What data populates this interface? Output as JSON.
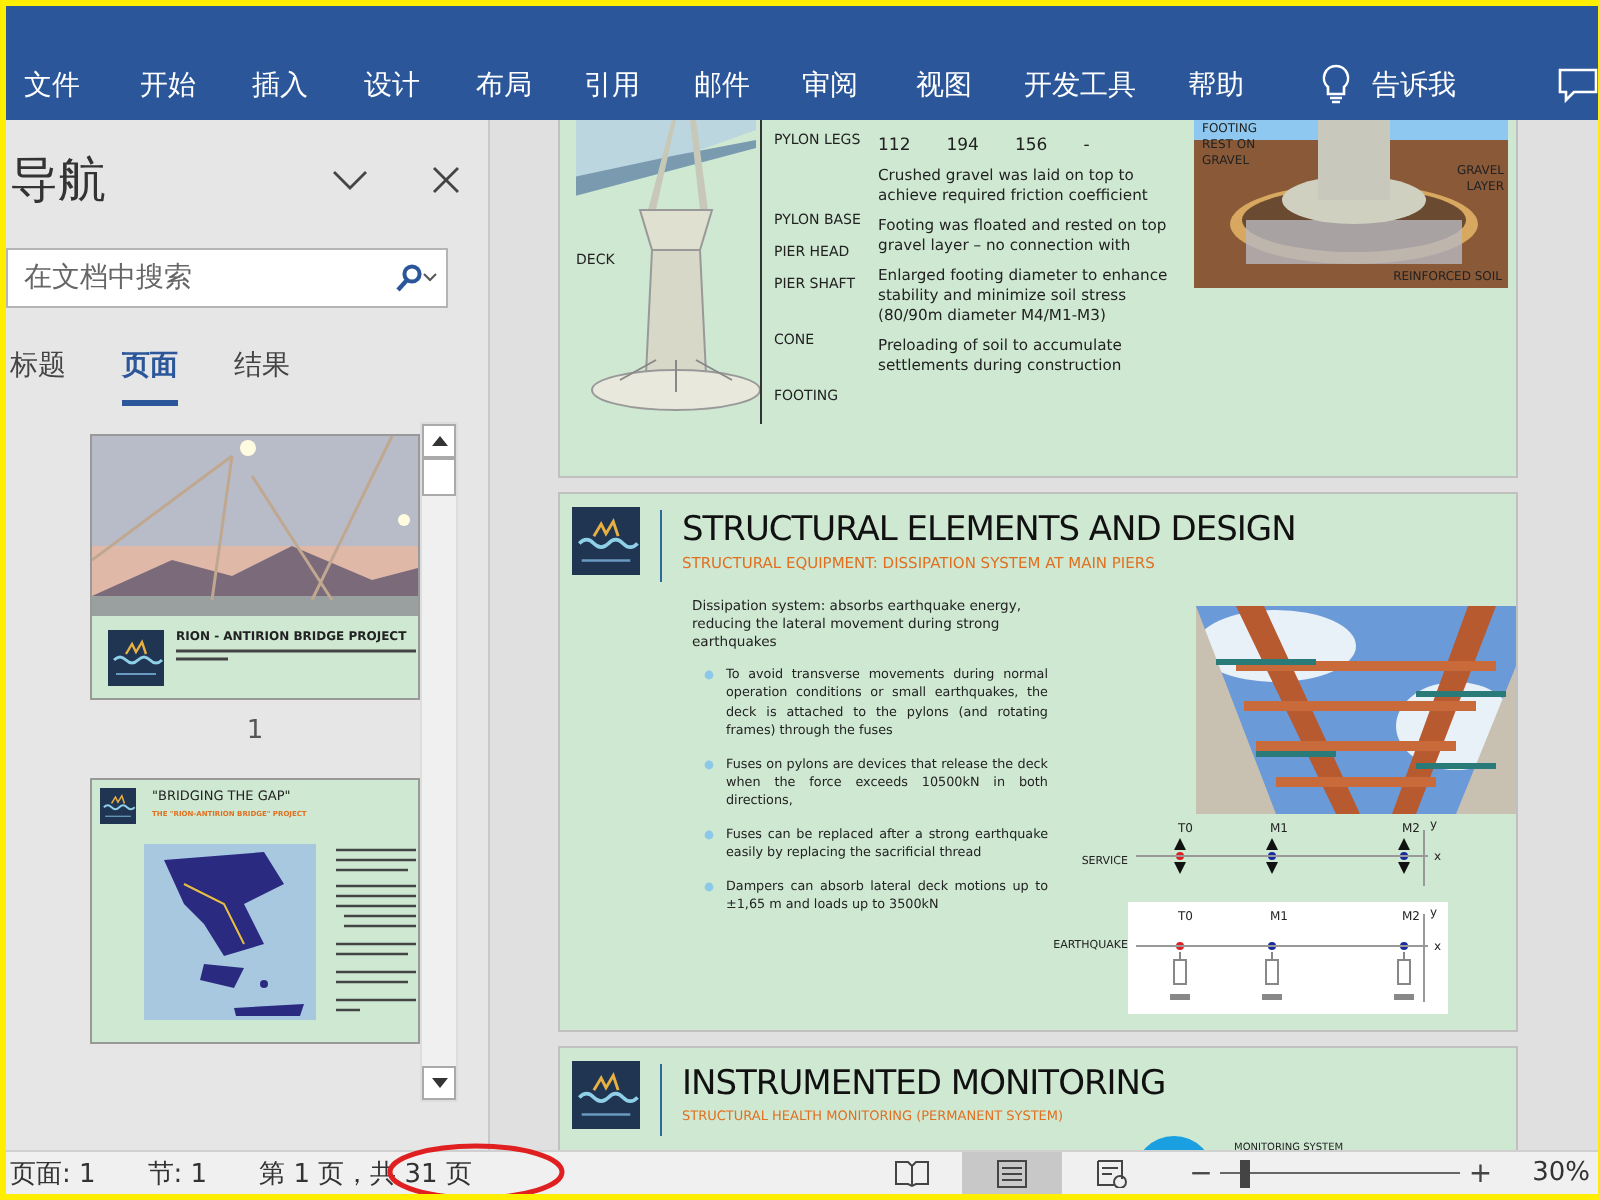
{
  "ribbon": {
    "tabs": [
      "文件",
      "开始",
      "插入",
      "设计",
      "布局",
      "引用",
      "邮件",
      "审阅",
      "视图",
      "开发工具",
      "帮助"
    ],
    "tell_me": "告诉我"
  },
  "navigation": {
    "title": "导航",
    "search": {
      "placeholder": "在文档中搜索"
    },
    "tabs": [
      {
        "label": "标题",
        "selected": false
      },
      {
        "label": "页面",
        "selected": true
      },
      {
        "label": "结果",
        "selected": false
      }
    ],
    "thumbnails": [
      {
        "kind": "cover",
        "title": "RION - ANTIRION BRIDGE PROJECT",
        "number": "1"
      },
      {
        "kind": "map",
        "title": "\"BRIDGING THE GAP\"",
        "subtitle": "THE \"RION-ANTIRION BRIDGE\" PROJECT"
      }
    ]
  },
  "pages": [
    {
      "kind": "pylon",
      "levels": [
        "PYLON LEGS",
        "PYLON BASE",
        "PIER HEAD",
        "PIER SHAFT",
        "CONE",
        "FOOTING"
      ],
      "deck_label": "DECK",
      "values": [
        "112",
        "194",
        "156",
        "-"
      ],
      "notes": [
        "Crushed gravel was laid on top to achieve required friction coefficient",
        "Footing was floated and rested on top gravel layer – no connection with",
        "Enlarged footing diameter to enhance stability and minimize soil stress (80/90m diameter M4/M1-M3)",
        "Preloading of soil to accumulate settlements during construction"
      ],
      "picture_labels": [
        "FOOTING REST ON GRAVEL",
        "GRAVEL LAYER",
        "REINFORCED SOIL"
      ]
    },
    {
      "kind": "dissipation",
      "title": "STRUCTURAL ELEMENTS AND DESIGN",
      "subtitle": "STRUCTURAL EQUIPMENT: DISSIPATION SYSTEM AT MAIN PIERS",
      "intro": "Dissipation system: absorbs earthquake energy, reducing the lateral movement during strong earthquakes",
      "bullets": [
        "To avoid transverse movements during normal operation conditions or small earthquakes, the deck is attached to the pylons (and rotating frames) through the fuses",
        "Fuses on pylons are devices that release the deck when the force exceeds 10500kN in both directions,",
        "Fuses can be replaced after a strong earthquake easily by replacing the sacrificial thread",
        "Dampers can absorb lateral deck motions up to ±1,65 m and loads up to 3500kN"
      ],
      "diagrams": [
        {
          "kind": "service",
          "label": "SERVICE",
          "x_axis": "x",
          "y_axis": "y",
          "nodes": [
            {
              "name": "T0",
              "color": "#e02020"
            },
            {
              "name": "M1",
              "color": "#1a2aa0"
            },
            {
              "name": "M2",
              "color": "#1a2aa0"
            }
          ]
        },
        {
          "kind": "earthquake",
          "label": "EARTHQUAKE",
          "x_axis": "x",
          "y_axis": "y",
          "nodes": [
            {
              "name": "T0",
              "color": "#e02020"
            },
            {
              "name": "M1",
              "color": "#1a2aa0"
            },
            {
              "name": "M2",
              "color": "#1a2aa0"
            }
          ]
        }
      ]
    },
    {
      "kind": "monitoring",
      "title": "INSTRUMENTED MONITORING",
      "subtitle": "STRUCTURAL HEALTH MONITORING (PERMANENT SYSTEM)",
      "caption": "MONITORING SYSTEM"
    }
  ],
  "status_bar": {
    "page": "页面: 1",
    "section": "节: 1",
    "page_count": "第 1 页，共 31 页",
    "views": [
      {
        "kind": "read",
        "selected": false
      },
      {
        "kind": "print",
        "selected": true
      },
      {
        "kind": "web",
        "selected": false
      }
    ],
    "zoom": {
      "minus": "−",
      "plus": "+",
      "level": 0.08,
      "reading": "30%"
    }
  }
}
